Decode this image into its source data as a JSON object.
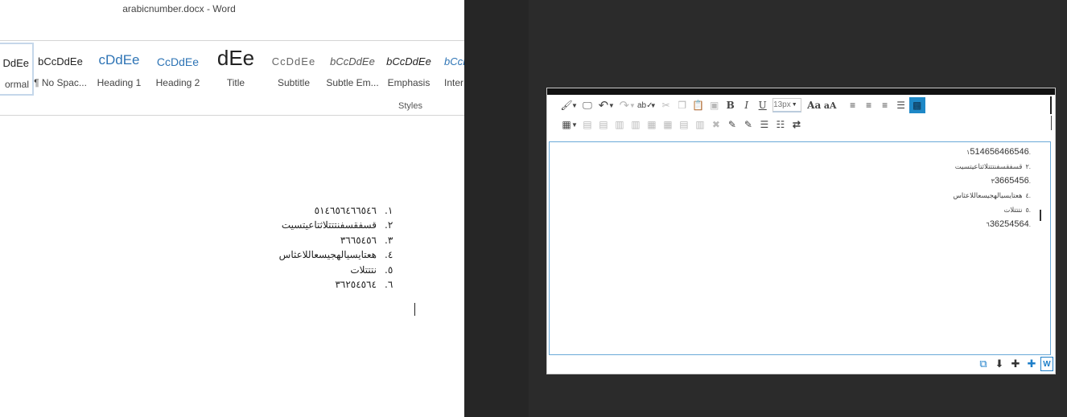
{
  "word": {
    "title": "arabicnumber.docx - Word",
    "styles_group_label": "Styles",
    "styles": [
      {
        "preview": "DdEe",
        "name": "ormal",
        "selected": true
      },
      {
        "preview": "bCcDdEe",
        "name": "¶ No Spac...",
        "selected": false
      },
      {
        "preview": "cDdEe",
        "name": "Heading 1",
        "selected": false
      },
      {
        "preview": "CcDdEe",
        "name": "Heading 2",
        "selected": false
      },
      {
        "preview": "dEe",
        "name": "Title",
        "selected": false
      },
      {
        "preview": "CcDdEe",
        "name": "Subtitle",
        "selected": false
      },
      {
        "preview": "bCcDdEe",
        "name": "Subtle Em...",
        "selected": false
      },
      {
        "preview": "bCcDdEe",
        "name": "Emphasis",
        "selected": false
      },
      {
        "preview": "bCcL",
        "name": "Inter",
        "selected": false
      }
    ],
    "document_list": [
      {
        "num": ".١",
        "text": "٥١٤٦٥٦٤٦٦٥٤٦"
      },
      {
        "num": ".٢",
        "text": "قسفقسفنتتتلاثتاعيتسيت"
      },
      {
        "num": ".٣",
        "text": "٣٦٦٥٤٥٦"
      },
      {
        "num": ".٤",
        "text": "هعتايسيالهجيسعاللاعثاس"
      },
      {
        "num": ".٥",
        "text": "نتتتلات"
      },
      {
        "num": ".٦",
        "text": "٣٦٢٥٤٥٦٤"
      }
    ]
  },
  "editor": {
    "font_size": "13px",
    "content_list": [
      {
        "num": ".١",
        "text": "514656466546",
        "script": "en"
      },
      {
        "num": ".٢",
        "text": "قسفقسفنتتتلاثتاعيتسيت",
        "script": "ar"
      },
      {
        "num": ".٣",
        "text": "3665456",
        "script": "en"
      },
      {
        "num": ".٤",
        "text": "هعتايسيالهجيسعاللاعثاس",
        "script": "ar"
      },
      {
        "num": ".٥",
        "text": "نتتتلات",
        "script": "ar"
      },
      {
        "num": ".٦",
        "text": "36254564",
        "script": "en"
      }
    ],
    "toolbar_row1": [
      "format-painter-icon",
      "screen-icon",
      "undo-icon",
      "redo-icon",
      "spellcheck-icon",
      "cut-icon",
      "copy-icon",
      "paste-icon",
      "select-all-icon",
      "bold-icon",
      "italic-icon",
      "underline-icon",
      "font-size-select",
      "font-bigger-icon",
      "font-smaller-icon",
      "align-left-icon",
      "align-center-icon",
      "align-right-icon",
      "justify-icon",
      "highlight-icon"
    ],
    "toolbar_row2": [
      "table-icon",
      "insert-row-above-icon",
      "insert-row-below-icon",
      "insert-col-left-icon",
      "insert-col-right-icon",
      "merge-cells-icon",
      "split-cells-icon",
      "delete-row-icon",
      "delete-col-icon",
      "delete-table-icon",
      "table-props-icon",
      "cell-props-icon",
      "bullet-list-icon",
      "numbered-list-icon",
      "text-direction-icon"
    ],
    "bottom_icons": [
      "expand-icon",
      "download-icon",
      "add-icon",
      "add-alt-icon",
      "word-export-icon"
    ]
  },
  "colors": {
    "dark_bg": "#2b2b2b",
    "accent_blue": "#1e88c7",
    "editor_border": "#6aa9d8"
  }
}
